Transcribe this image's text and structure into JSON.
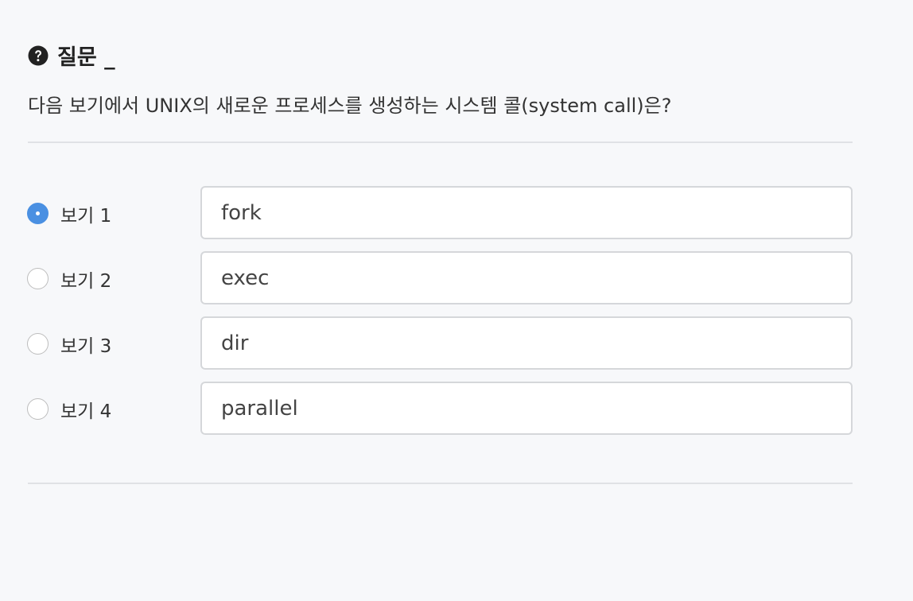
{
  "header": {
    "icon": "question-circle-icon",
    "title": "질문 _"
  },
  "question": {
    "text": "다음 보기에서 UNIX의 새로운 프로세스를 생성하는 시스템 콜(system call)은?"
  },
  "options": [
    {
      "label": "보기 1",
      "value": "fork",
      "selected": true
    },
    {
      "label": "보기 2",
      "value": "exec",
      "selected": false
    },
    {
      "label": "보기 3",
      "value": "dir",
      "selected": false
    },
    {
      "label": "보기 4",
      "value": "parallel",
      "selected": false
    }
  ],
  "colors": {
    "accent": "#4a90e2",
    "background": "#f7f8fa",
    "divider": "#e0e2e5"
  }
}
